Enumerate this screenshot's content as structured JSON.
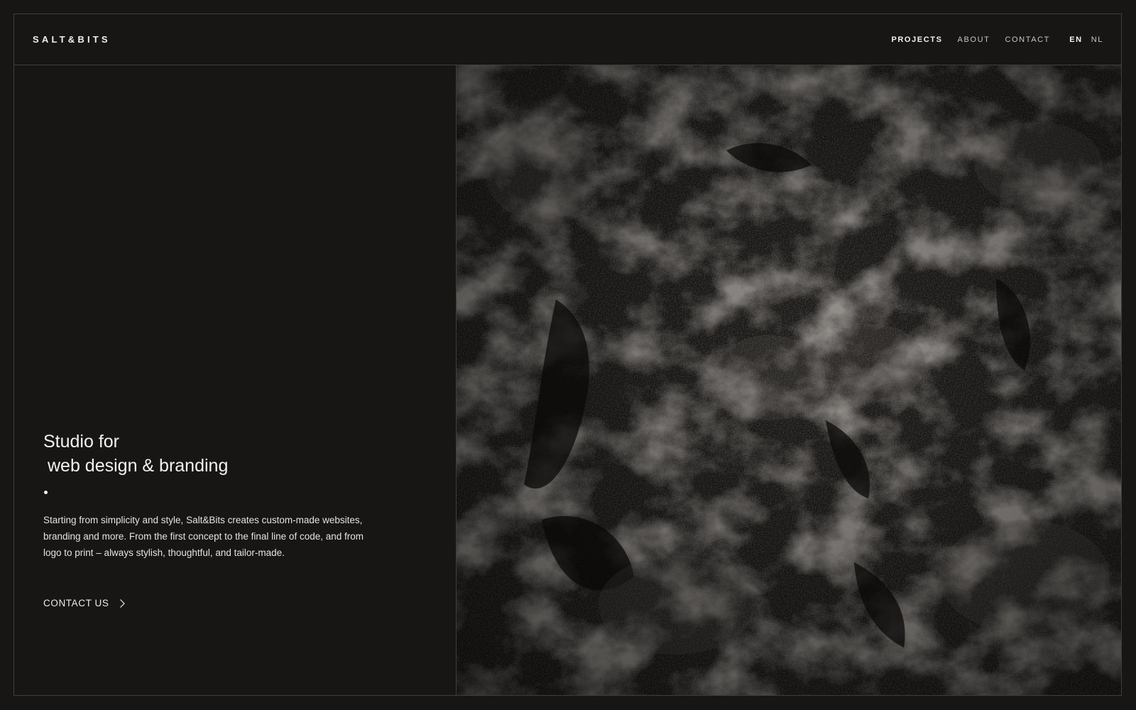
{
  "header": {
    "logo": "SALT&BITS",
    "nav": [
      {
        "label": "PROJECTS",
        "active": true
      },
      {
        "label": "ABOUT",
        "active": false
      },
      {
        "label": "CONTACT",
        "active": false
      }
    ],
    "languages": [
      {
        "label": "EN",
        "active": true
      },
      {
        "label": "NL",
        "active": false
      }
    ]
  },
  "hero": {
    "headline_line1": "Studio for",
    "headline_line2": "web design & branding",
    "description": "Starting from simplicity and style, Salt&Bits creates custom-made websites, branding and more. From the first concept to the final line of code, and from logo to print – always stylish, thoughtful, and tailor-made.",
    "cta_label": "CONTACT US",
    "cta_icon": "chevron-right-icon"
  },
  "colors": {
    "background": "#171615",
    "border": "#3f3d3a",
    "text": "#eeece8"
  }
}
